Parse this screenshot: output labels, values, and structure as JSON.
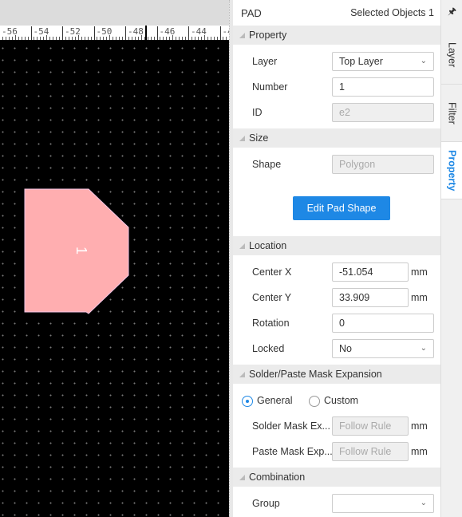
{
  "ruler": {
    "labels": [
      "-56",
      "-54",
      "-52",
      "-50",
      "-48",
      "-46",
      "-44",
      "-4"
    ]
  },
  "canvas": {
    "pad_number": "1",
    "pad_color": "#ffaeb0"
  },
  "panel": {
    "title": "PAD",
    "selected_label": "Selected Objects",
    "selected_count": "1",
    "sections": {
      "property": "Property",
      "size": "Size",
      "location": "Location",
      "mask": "Solder/Paste Mask Expansion",
      "combination": "Combination"
    },
    "layer": {
      "label": "Layer",
      "value": "Top Layer"
    },
    "number": {
      "label": "Number",
      "value": "1"
    },
    "id": {
      "label": "ID",
      "value": "e2"
    },
    "shape": {
      "label": "Shape",
      "value": "Polygon"
    },
    "edit_button": "Edit Pad Shape",
    "center_x": {
      "label": "Center X",
      "value": "-51.054",
      "unit": "mm"
    },
    "center_y": {
      "label": "Center Y",
      "value": "33.909",
      "unit": "mm"
    },
    "rotation": {
      "label": "Rotation",
      "value": "0"
    },
    "locked": {
      "label": "Locked",
      "value": "No"
    },
    "radio": {
      "general": "General",
      "custom": "Custom",
      "selected": "General"
    },
    "solder": {
      "label": "Solder Mask Ex...",
      "value": "Follow Rule",
      "unit": "mm"
    },
    "paste": {
      "label": "Paste Mask Exp...",
      "value": "Follow Rule",
      "unit": "mm"
    },
    "group": {
      "label": "Group",
      "value": ""
    }
  },
  "tabs": {
    "layer": "Layer",
    "filter": "Filter",
    "property": "Property",
    "active": "Property",
    "accent": "#1e88e5"
  }
}
